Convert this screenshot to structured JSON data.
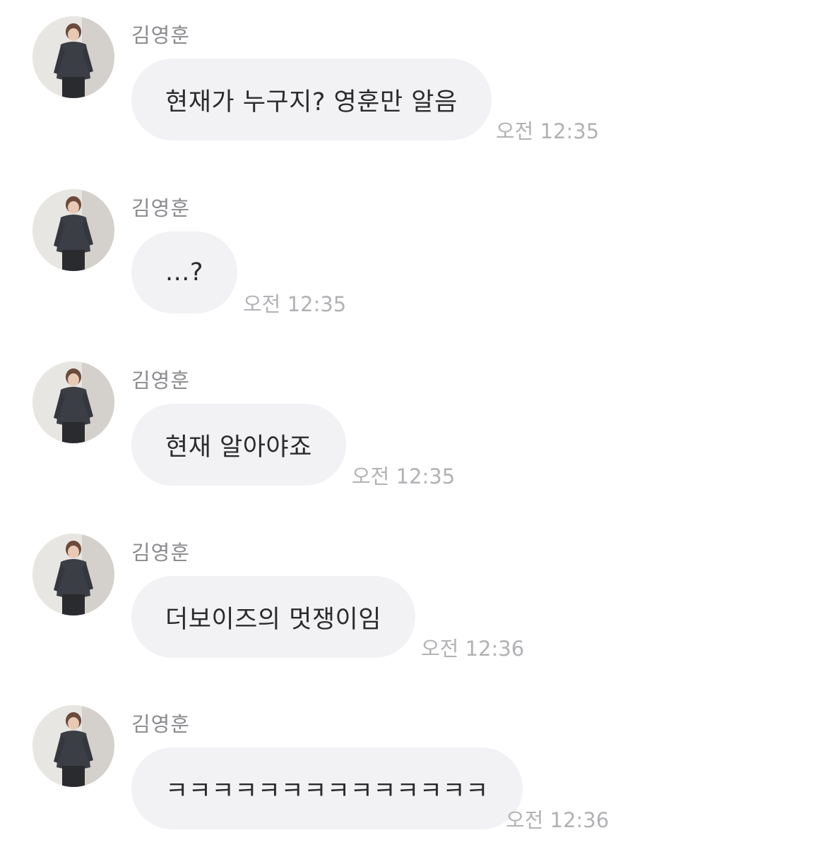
{
  "messages": [
    {
      "sender": "김영훈",
      "text": "현재가 누구지? 영훈만 알음",
      "time": "오전 12:35",
      "avatar_icon": "profile-photo"
    },
    {
      "sender": "김영훈",
      "text": "...?",
      "time": "오전 12:35",
      "avatar_icon": "profile-photo"
    },
    {
      "sender": "김영훈",
      "text": "현재 알아야죠",
      "time": "오전 12:35",
      "avatar_icon": "profile-photo"
    },
    {
      "sender": "김영훈",
      "text": "더보이즈의 멋쟁이임",
      "time": "오전 12:36",
      "avatar_icon": "profile-photo"
    },
    {
      "sender": "김영훈",
      "text": "ㅋㅋㅋㅋㅋㅋㅋㅋㅋㅋㅋㅋㅋㅋ",
      "time": "오전 12:36",
      "avatar_icon": "profile-photo"
    }
  ],
  "colors": {
    "bubble_background": "#f2f2f5",
    "bubble_text": "#2b2b2e",
    "sender_name": "#8b8b8f",
    "timestamp": "#b2b2b6"
  }
}
